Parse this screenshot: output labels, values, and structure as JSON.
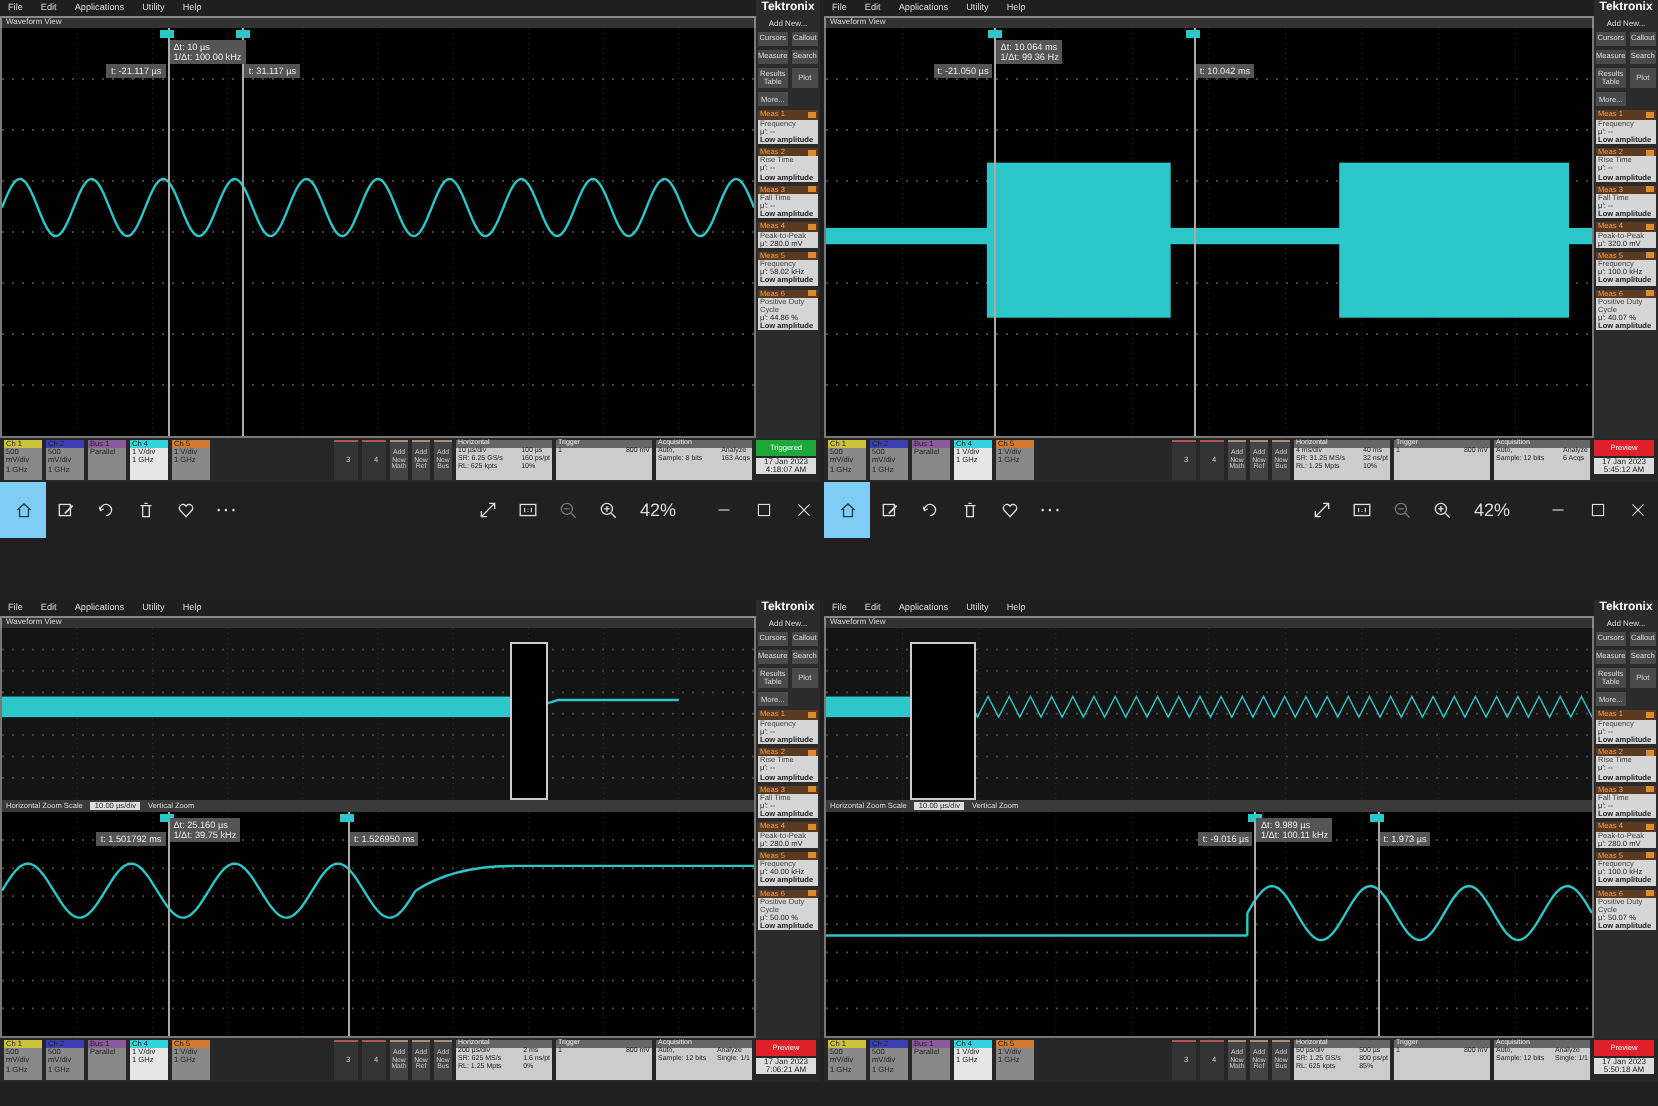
{
  "scopes": [
    {
      "menu": [
        "File",
        "Edit",
        "Applications",
        "Utility",
        "Help"
      ],
      "view_title": "Waveform View",
      "brand": "Tektronix",
      "add_new": "Add New...",
      "tools": [
        "Cursors",
        "Callout",
        "Measure",
        "Search",
        "Results Table",
        "Plot",
        "More..."
      ],
      "waveform": {
        "kind": "sine"
      },
      "cursor_a": "t: -21.117 µs",
      "delta": [
        "Δt: 10 µs",
        "1/Δt: 100.00 kHz"
      ],
      "cursor_b": "t: 31.117 µs",
      "measurements": [
        {
          "title": "Meas 1",
          "name": "Frequency",
          "value": "μ': --",
          "note": "Low amplitude"
        },
        {
          "title": "Meas 2",
          "name": "Rise Time",
          "value": "μ': --",
          "note": "Low amplitude"
        },
        {
          "title": "Meas 3",
          "name": "Fall Time",
          "value": "μ': --",
          "note": "Low amplitude"
        },
        {
          "title": "Meas 4",
          "name": "Peak-to-Peak",
          "value": "μ': 280.0 mV"
        },
        {
          "title": "Meas 5",
          "name": "Frequency",
          "value": "μ': 58.02 kHz",
          "note": "Low amplitude"
        },
        {
          "title": "Meas 6",
          "name": "Positive Duty Cycle",
          "value": "μ': 44.86 %",
          "note": "Low amplitude"
        }
      ],
      "channels": [
        {
          "label": "Ch 1",
          "lines": [
            "500 mV/div",
            "1 GHz"
          ],
          "color": "#c9c33a",
          "selected": false
        },
        {
          "label": "Ch 2",
          "lines": [
            "500 mV/div",
            "1 GHz"
          ],
          "color": "#3d3db4",
          "selected": false
        },
        {
          "label": "Bus 1",
          "lines": [
            "Parallel"
          ],
          "color": "#8a5a9a",
          "selected": false
        },
        {
          "label": "Ch 4",
          "lines": [
            "1 V/div",
            "1 GHz"
          ],
          "color": "#2fd3dc",
          "selected": true
        },
        {
          "label": "Ch 5",
          "lines": [
            "1 V/div",
            "1 GHz"
          ],
          "color": "#d07a30",
          "selected": false
        }
      ],
      "inactive": [
        "3",
        "4"
      ],
      "add_buttons": [
        "Add New Math",
        "Add New Ref",
        "Add New Bus"
      ],
      "horizontal": {
        "title": "Horizontal",
        "lines": [
          "10 µs/div",
          "100 µs",
          "SR: 6.25 GS/s",
          "160 ps/pt",
          "RL: 625 kpts",
          "10%"
        ]
      },
      "trigger": {
        "title": "Trigger",
        "lines": [
          "1",
          "800 mV"
        ]
      },
      "acquisition": {
        "title": "Acquisition",
        "lines": [
          "Auto,",
          "Analyze",
          "Sample: 8 bits",
          "163 Acqs"
        ]
      },
      "status": {
        "label": "Triggered",
        "kind": "triggered"
      },
      "date": [
        "17 Jan 2023",
        "4:18:07 AM"
      ]
    },
    {
      "menu": [
        "File",
        "Edit",
        "Applications",
        "Utility",
        "Help"
      ],
      "view_title": "Waveform View",
      "brand": "Tektronix",
      "add_new": "Add New...",
      "tools": [
        "Cursors",
        "Callout",
        "Measure",
        "Search",
        "Results Table",
        "Plot",
        "More..."
      ],
      "waveform": {
        "kind": "burst"
      },
      "cursor_a": "t: -21.050 µs",
      "delta": [
        "Δt: 10.064 ms",
        "1/Δt: 99.36 Hz"
      ],
      "cursor_b": "t: 10.042 ms",
      "measurements": [
        {
          "title": "Meas 1",
          "name": "Frequency",
          "value": "μ': --",
          "note": "Low amplitude"
        },
        {
          "title": "Meas 2",
          "name": "Rise Time",
          "value": "μ': --",
          "note": "Low amplitude"
        },
        {
          "title": "Meas 3",
          "name": "Fall Time",
          "value": "μ': --",
          "note": "Low amplitude"
        },
        {
          "title": "Meas 4",
          "name": "Peak-to-Peak",
          "value": "μ': 320.0 mV"
        },
        {
          "title": "Meas 5",
          "name": "Frequency",
          "value": "μ': 100.0 kHz",
          "note": "Low amplitude"
        },
        {
          "title": "Meas 6",
          "name": "Positive Duty Cycle",
          "value": "μ': 40.07 %",
          "note": "Low amplitude"
        }
      ],
      "channels": [
        {
          "label": "Ch 1",
          "lines": [
            "500 mV/div",
            "1 GHz"
          ],
          "color": "#c9c33a",
          "selected": false
        },
        {
          "label": "Ch 2",
          "lines": [
            "500 mV/div",
            "1 GHz"
          ],
          "color": "#3d3db4",
          "selected": false
        },
        {
          "label": "Bus 1",
          "lines": [
            "Parallel"
          ],
          "color": "#8a5a9a",
          "selected": false
        },
        {
          "label": "Ch 4",
          "lines": [
            "1 V/div",
            "1 GHz"
          ],
          "color": "#2fd3dc",
          "selected": true
        },
        {
          "label": "Ch 5",
          "lines": [
            "1 V/div",
            "1 GHz"
          ],
          "color": "#d07a30",
          "selected": false
        }
      ],
      "inactive": [
        "3",
        "4"
      ],
      "add_buttons": [
        "Add New Math",
        "Add New Ref",
        "Add New Bus"
      ],
      "horizontal": {
        "title": "Horizontal",
        "lines": [
          "4 ms/div",
          "40 ms",
          "SR: 31.25 MS/s",
          "32 ns/pt",
          "RL: 1.25 Mpts",
          "10%"
        ]
      },
      "trigger": {
        "title": "Trigger",
        "lines": [
          "1",
          "800 mV"
        ]
      },
      "acquisition": {
        "title": "Acquisition",
        "lines": [
          "Auto,",
          "Analyze",
          "Sample: 12 bits",
          "6 Acqs"
        ]
      },
      "status": {
        "label": "Preview",
        "kind": "preview"
      },
      "date": [
        "17 Jan 2023",
        "5:45:12 AM"
      ]
    },
    {
      "menu": [
        "File",
        "Edit",
        "Applications",
        "Utility",
        "Help"
      ],
      "view_title": "Waveform View",
      "brand": "Tektronix",
      "add_new": "Add New...",
      "tools": [
        "Cursors",
        "Callout",
        "Measure",
        "Search",
        "Results Table",
        "Plot",
        "More..."
      ],
      "waveform": {
        "kind": "zoom_end"
      },
      "zoom_bar": [
        "Horizontal Zoom Scale",
        "10.00 µs/div",
        "Vertical Zoom"
      ],
      "cursor_a": "t: 1.501792 ms",
      "delta": [
        "Δt: 25.160 µs",
        "1/Δt: 39.75 kHz"
      ],
      "cursor_b": "t: 1.526950 ms",
      "measurements": [
        {
          "title": "Meas 1",
          "name": "Frequency",
          "value": "μ': --",
          "note": "Low amplitude"
        },
        {
          "title": "Meas 2",
          "name": "Rise Time",
          "value": "μ': --",
          "note": "Low amplitude"
        },
        {
          "title": "Meas 3",
          "name": "Fall Time",
          "value": "μ': --",
          "note": "Low amplitude"
        },
        {
          "title": "Meas 4",
          "name": "Peak-to-Peak",
          "value": "μ': 280.0 mV"
        },
        {
          "title": "Meas 5",
          "name": "Frequency",
          "value": "μ': 40.00 kHz",
          "note": "Low amplitude"
        },
        {
          "title": "Meas 6",
          "name": "Positive Duty Cycle",
          "value": "μ': 50.00 %",
          "note": "Low amplitude"
        }
      ],
      "channels": [
        {
          "label": "Ch 1",
          "lines": [
            "500 mV/div",
            "1 GHz"
          ],
          "color": "#c9c33a",
          "selected": false
        },
        {
          "label": "Ch 2",
          "lines": [
            "500 mV/div",
            "1 GHz"
          ],
          "color": "#3d3db4",
          "selected": false
        },
        {
          "label": "Bus 1",
          "lines": [
            "Parallel"
          ],
          "color": "#8a5a9a",
          "selected": false
        },
        {
          "label": "Ch 4",
          "lines": [
            "1 V/div",
            "1 GHz"
          ],
          "color": "#2fd3dc",
          "selected": true
        },
        {
          "label": "Ch 5",
          "lines": [
            "1 V/div",
            "1 GHz"
          ],
          "color": "#d07a30",
          "selected": false
        }
      ],
      "inactive": [
        "3",
        "4"
      ],
      "add_buttons": [
        "Add New Math",
        "Add New Ref",
        "Add New Bus"
      ],
      "horizontal": {
        "title": "Horizontal",
        "lines": [
          "200 µs/div",
          "2 ms",
          "SR: 625 MS/s",
          "1.6 ns/pt",
          "RL: 1.25 Mpts",
          "0%"
        ]
      },
      "trigger": {
        "title": "Trigger",
        "lines": [
          "1",
          "800 mV"
        ]
      },
      "acquisition": {
        "title": "Acquisition",
        "lines": [
          "Auto,",
          "Analyze",
          "Sample: 12 bits",
          "Single: 1/1"
        ]
      },
      "status": {
        "label": "Preview",
        "kind": "preview"
      },
      "date": [
        "17 Jan 2023",
        "7:06:21 AM"
      ]
    },
    {
      "menu": [
        "File",
        "Edit",
        "Applications",
        "Utility",
        "Help"
      ],
      "view_title": "Waveform View",
      "brand": "Tektronix",
      "add_new": "Add New...",
      "tools": [
        "Cursors",
        "Callout",
        "Measure",
        "Search",
        "Results Table",
        "Plot",
        "More..."
      ],
      "waveform": {
        "kind": "zoom_start"
      },
      "zoom_bar": [
        "Horizontal Zoom Scale",
        "10.00 µs/div",
        "Vertical Zoom"
      ],
      "cursor_a": "t: -9.016 µs",
      "delta": [
        "Δt: 9.989 µs",
        "1/Δt: 100.11 kHz"
      ],
      "cursor_b": "t: 1.973 µs",
      "measurements": [
        {
          "title": "Meas 1",
          "name": "Frequency",
          "value": "μ': --",
          "note": "Low amplitude"
        },
        {
          "title": "Meas 2",
          "name": "Rise Time",
          "value": "μ': --",
          "note": "Low amplitude"
        },
        {
          "title": "Meas 3",
          "name": "Fall Time",
          "value": "μ': --",
          "note": "Low amplitude"
        },
        {
          "title": "Meas 4",
          "name": "Peak-to-Peak",
          "value": "μ': 280.0 mV"
        },
        {
          "title": "Meas 5",
          "name": "Frequency",
          "value": "μ': 100.0 kHz",
          "note": "Low amplitude"
        },
        {
          "title": "Meas 6",
          "name": "Positive Duty Cycle",
          "value": "μ': 50.07 %",
          "note": "Low amplitude"
        }
      ],
      "channels": [
        {
          "label": "Ch 1",
          "lines": [
            "500 mV/div",
            "1 GHz"
          ],
          "color": "#c9c33a",
          "selected": false
        },
        {
          "label": "Ch 2",
          "lines": [
            "500 mV/div",
            "1 GHz"
          ],
          "color": "#3d3db4",
          "selected": false
        },
        {
          "label": "Bus 1",
          "lines": [
            "Parallel"
          ],
          "color": "#8a5a9a",
          "selected": false
        },
        {
          "label": "Ch 4",
          "lines": [
            "1 V/div",
            "1 GHz"
          ],
          "color": "#2fd3dc",
          "selected": true
        },
        {
          "label": "Ch 5",
          "lines": [
            "1 V/div",
            "1 GHz"
          ],
          "color": "#d07a30",
          "selected": false
        }
      ],
      "inactive": [
        "3",
        "4"
      ],
      "add_buttons": [
        "Add New Math",
        "Add New Ref",
        "Add New Bus"
      ],
      "horizontal": {
        "title": "Horizontal",
        "lines": [
          "50 µs/div",
          "500 µs",
          "SR: 1.25 GS/s",
          "800 ps/pt",
          "RL: 625 kpts",
          "85%"
        ]
      },
      "trigger": {
        "title": "Trigger",
        "lines": [
          "1",
          "800 mV"
        ]
      },
      "acquisition": {
        "title": "Acquisition",
        "lines": [
          "Auto,",
          "Analyze",
          "Sample: 12 bits",
          "Single: 1/1"
        ]
      },
      "status": {
        "label": "Preview",
        "kind": "preview"
      },
      "date": [
        "17 Jan 2023",
        "5:50:18 AM"
      ]
    }
  ],
  "viewer_toolbars": [
    {
      "buttons": [
        {
          "kind": "home",
          "selected": true
        },
        {
          "kind": "edit",
          "selected": false
        },
        {
          "kind": "rotate",
          "selected": false
        },
        {
          "kind": "delete",
          "selected": false
        },
        {
          "kind": "favorite",
          "selected": false
        }
      ],
      "more": "···",
      "zoom": "42%"
    },
    {
      "buttons": [
        {
          "kind": "home",
          "selected": true
        },
        {
          "kind": "edit",
          "selected": false
        },
        {
          "kind": "rotate",
          "selected": false
        },
        {
          "kind": "delete",
          "selected": false
        },
        {
          "kind": "favorite",
          "selected": false
        }
      ],
      "more": "···",
      "zoom": "42%"
    }
  ]
}
